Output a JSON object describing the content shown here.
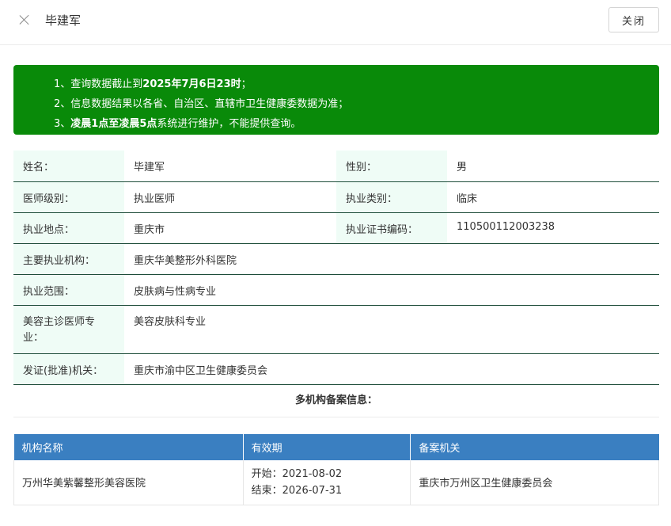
{
  "header": {
    "title": "毕建军",
    "close_label": "关闭"
  },
  "notice": {
    "line1_pre": "1、查询数据截止到",
    "line1_bold": "2025年7月6日23时",
    "line1_post": "；",
    "line2": "2、信息数据结果以各省、自治区、直辖市卫生健康委数据为准；",
    "line3_pre": "3、",
    "line3_bold": "凌晨1点至凌晨5点",
    "line3_post": "系统进行维护，不能提供查询。"
  },
  "info": {
    "name_label": "姓名：",
    "name": "毕建军",
    "gender_label": "性别：",
    "gender": "男",
    "level_label": "医师级别：",
    "level": "执业医师",
    "category_label": "执业类别：",
    "category": "临床",
    "location_label": "执业地点：",
    "location": "重庆市",
    "cert_label": "执业证书编码：",
    "cert": "110500112003238",
    "org_label": "主要执业机构：",
    "org": "重庆华美整形外科医院",
    "scope_label": "执业范围：",
    "scope": "皮肤病与性病专业",
    "cosmetic_label": "美容主诊医师专业：",
    "cosmetic": "美容皮肤科专业",
    "issuer_label": "发证(批准)机关：",
    "issuer": "重庆市渝中区卫生健康委员会"
  },
  "multi": {
    "title": "多机构备案信息：",
    "headers": [
      "机构名称",
      "有效期",
      "备案机关"
    ],
    "rows": [
      {
        "name": "万州华美紫馨整形美容医院",
        "start": "开始：2021-08-02",
        "end": "结束：2026-07-31",
        "authority": "重庆市万州区卫生健康委员会"
      }
    ]
  }
}
